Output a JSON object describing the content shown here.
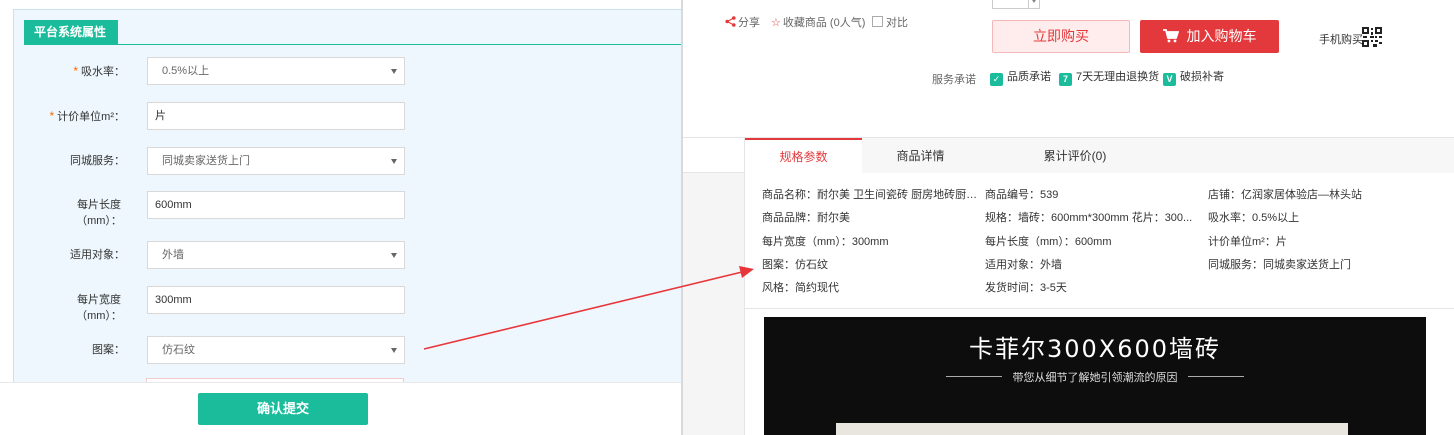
{
  "left_form": {
    "section_title": "平台系统属性",
    "fields": [
      {
        "label": "吸水率：",
        "required": true,
        "value": "0.5%以上",
        "kind": "select"
      },
      {
        "label": "计价单位m²：",
        "required": true,
        "value": "片",
        "kind": "input"
      },
      {
        "label": "同城服务：",
        "required": false,
        "value": "同城卖家送货上门",
        "kind": "select"
      },
      {
        "label": "每片长度（mm）：",
        "required": false,
        "value": "600mm",
        "kind": "input"
      },
      {
        "label": "适用对象：",
        "required": false,
        "value": "外墙",
        "kind": "select"
      },
      {
        "label": "每片宽度（mm）：",
        "required": false,
        "value": "300mm",
        "kind": "input"
      },
      {
        "label": "图案：",
        "required": false,
        "value": "仿石纹",
        "kind": "select"
      }
    ],
    "required_mark": "*",
    "submit_label": "确认提交"
  },
  "product": {
    "share_label": "分享",
    "favorite_label": "收藏商品 (0人气)",
    "compare_label": "对比",
    "buy_now_label": "立即购买",
    "add_to_cart_label": "加入购物车",
    "mobile_buy_label": "手机购买",
    "service_label": "服务承诺",
    "services": [
      {
        "badge": "",
        "label": "品质承诺"
      },
      {
        "badge": "7",
        "label": "7天无理由退换货"
      },
      {
        "badge": "",
        "label": "破损补寄"
      }
    ]
  },
  "tabs": [
    {
      "label": "规格参数",
      "active": true
    },
    {
      "label": "商品详情",
      "active": false
    },
    {
      "label": "累计评价(0)",
      "active": false
    }
  ],
  "specs": [
    [
      "商品名称：耐尔美 卫生间瓷砖 厨房地砖厨卫...",
      "商品编号：539",
      "店铺：亿润家居体验店—林头站"
    ],
    [
      "商品品牌：耐尔美",
      "规格：墙砖：600mm*300mm  花片：300...",
      "吸水率：0.5%以上"
    ],
    [
      "每片宽度（mm）：300mm",
      "每片长度（mm）：600mm",
      "计价单位m²：片"
    ],
    [
      "图案：仿石纹",
      "适用对象：外墙",
      "同城服务：同城卖家送货上门"
    ],
    [
      "风格：简约现代",
      "发货时间：3-5天",
      ""
    ]
  ],
  "promo": {
    "title": "卡菲尔300X600墙砖",
    "subtitle": "带您从细节了解她引领潮流的原因"
  },
  "colors": {
    "accent_green": "#1bbc9b",
    "accent_red": "#e4393c",
    "arrow_red": "#e8353a"
  }
}
